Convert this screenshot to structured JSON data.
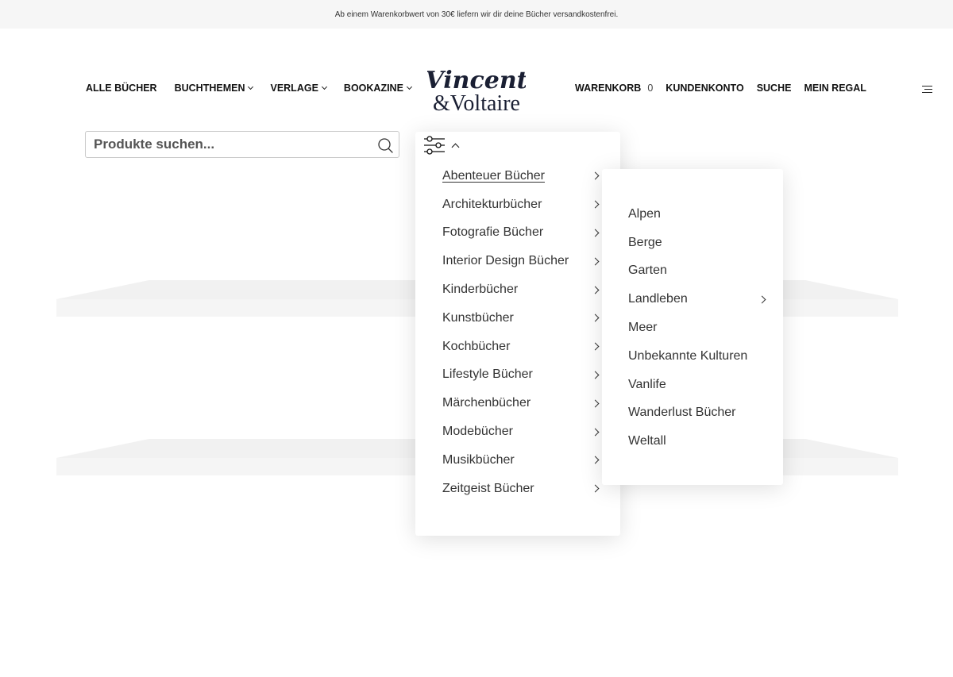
{
  "announcement": "Ab einem Warenkorbwert von 30€ liefern wir dir deine Bücher versandkostenfrei.",
  "nav_left": [
    {
      "label": "ALLE BÜCHER"
    },
    {
      "label": "BUCHTHEMEN"
    },
    {
      "label": "VERLAGE"
    },
    {
      "label": "BOOKAZINE"
    }
  ],
  "logo": {
    "line1": "Vincent",
    "line2": "&Voltaire"
  },
  "nav_right": {
    "cart_label": "WARENKORB",
    "cart_count": "0",
    "account": "KUNDENKONTO",
    "search": "SUCHE",
    "shelf": "MEIN REGAL"
  },
  "search": {
    "placeholder": "Produkte suchen..."
  },
  "category_menu": {
    "items": [
      {
        "label": "Abenteuer Bücher"
      },
      {
        "label": "Architekturbücher"
      },
      {
        "label": "Fotografie Bücher"
      },
      {
        "label": "Interior Design Bücher"
      },
      {
        "label": "Kinderbücher"
      },
      {
        "label": "Kunstbücher"
      },
      {
        "label": "Kochbücher"
      },
      {
        "label": "Lifestyle Bücher"
      },
      {
        "label": "Märchenbücher"
      },
      {
        "label": "Modebücher"
      },
      {
        "label": "Musikbücher"
      },
      {
        "label": "Zeitgeist Bücher"
      }
    ]
  },
  "submenu": {
    "items": [
      {
        "label": "Alpen"
      },
      {
        "label": "Berge"
      },
      {
        "label": "Garten"
      },
      {
        "label": "Landleben"
      },
      {
        "label": "Meer"
      },
      {
        "label": "Unbekannte Kulturen"
      },
      {
        "label": "Vanlife"
      },
      {
        "label": "Wanderlust Bücher"
      },
      {
        "label": "Weltall"
      }
    ]
  }
}
